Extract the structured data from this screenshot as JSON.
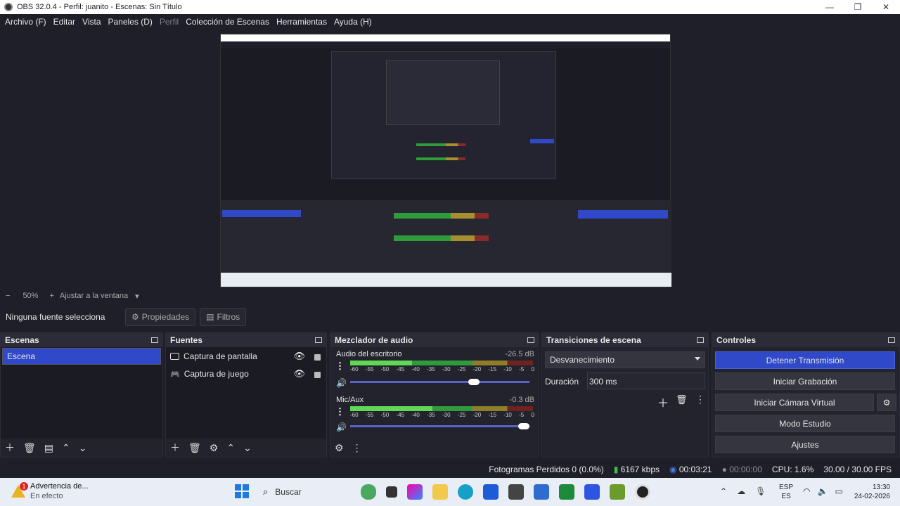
{
  "window": {
    "title": "OBS 32.0.4 - Perfil: juanito - Escenas: Sin Título"
  },
  "menu": {
    "items": [
      "Archivo (F)",
      "Editar",
      "Vista",
      "Paneles (D)",
      "Perfil",
      "Colección de Escenas",
      "Herramientas",
      "Ayuda (H)"
    ]
  },
  "zoom": {
    "minus": "−",
    "value": "50%",
    "plus": "+",
    "fit": "Ajustar a la ventana"
  },
  "source_bar": {
    "no_source": "Ninguna fuente selecciona",
    "properties": "Propiedades",
    "filters": "Filtros"
  },
  "scenes": {
    "title": "Escenas",
    "items": [
      "Escena"
    ]
  },
  "sources": {
    "title": "Fuentes",
    "items": [
      "Captura de pantalla",
      "Captura de juego"
    ]
  },
  "mixer": {
    "title": "Mezclador de audio",
    "channels": [
      {
        "name": "Audio del escritorio",
        "db": "-26.5 dB",
        "level": 0.34,
        "volume": 0.72
      },
      {
        "name": "Mic/Aux",
        "db": "-0.3 dB",
        "level": 0.45,
        "volume": 1.0
      }
    ],
    "ticks": [
      "-60",
      "-55",
      "-50",
      "-45",
      "-40",
      "-35",
      "-30",
      "-25",
      "-20",
      "-15",
      "-10",
      "-5",
      "0"
    ]
  },
  "transitions": {
    "title": "Transiciones de escena",
    "selected": "Desvanecimiento",
    "duration_label": "Duración",
    "duration_value": "300 ms"
  },
  "controls": {
    "title": "Controles",
    "stop_stream": "Detener Transmisión",
    "start_recording": "Iniciar Grabación",
    "start_virtual_cam": "Iniciar Cámara Virtual",
    "studio_mode": "Modo Estudio",
    "settings": "Ajustes"
  },
  "status": {
    "dropped_frames": "Fotogramas Perdidos 0 (0.0%)",
    "bitrate": "6167 kbps",
    "stream_time": "00:03:21",
    "rec_time": "00:00:00",
    "cpu": "CPU: 1.6%",
    "fps": "30.00 / 30.00 FPS"
  },
  "taskbar": {
    "notification_title": "Advertencia de...",
    "notification_sub": "En efecto",
    "search": "Buscar",
    "lang_top": "ESP",
    "lang_bottom": "ES",
    "time": "13:30",
    "date": "24-02-2026"
  },
  "colors": {
    "accent": "#2f49c9",
    "panel": "#22232d",
    "background": "#1e1f29"
  }
}
